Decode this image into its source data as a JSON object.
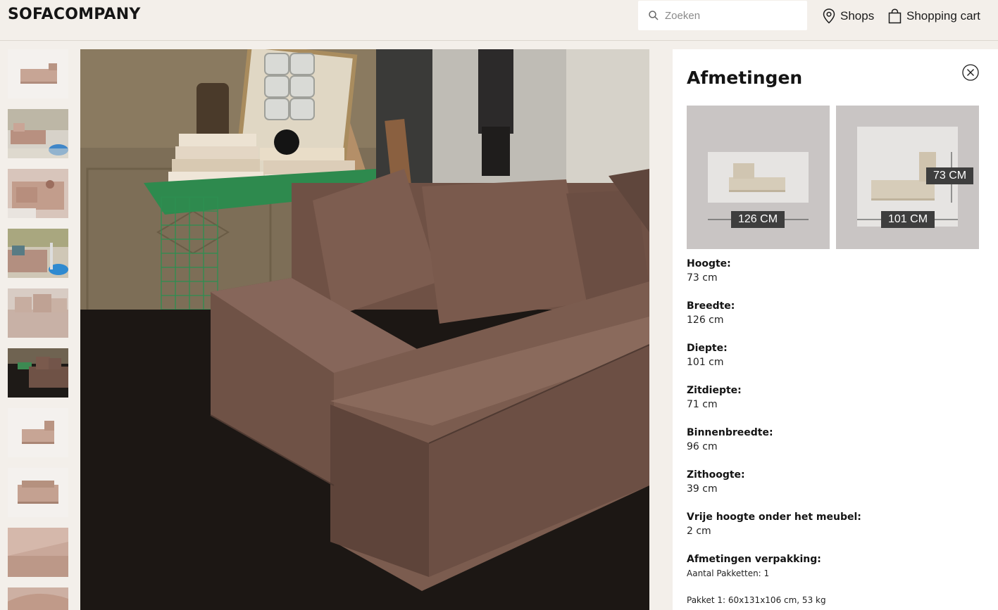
{
  "header": {
    "logo": "SOFACOMPANY",
    "search_placeholder": "Zoeken",
    "shops_label": "Shops",
    "cart_label": "Shopping cart"
  },
  "gallery": {
    "thumbnails": [
      "sofa-module-front",
      "living-room-blue-pouf",
      "sofa-top-view",
      "living-room-cushions",
      "sofa-cushions-closeup",
      "dark-room-sofa",
      "sofa-module-side",
      "sofa-module-back",
      "fabric-corner-closeup",
      "sofa-armrest-detail"
    ],
    "main_image": "brown-boucle-sofa-in-room"
  },
  "panel": {
    "title": "Afmetingen",
    "diagram_front_label": "126 CM",
    "diagram_side_width_label": "101 CM",
    "diagram_side_height_label": "73 CM",
    "specs": [
      {
        "label": "Hoogte:",
        "value": "73 cm"
      },
      {
        "label": "Breedte:",
        "value": "126 cm"
      },
      {
        "label": "Diepte:",
        "value": "101 cm"
      },
      {
        "label": "Zitdiepte:",
        "value": "71 cm"
      },
      {
        "label": "Binnenbreedte:",
        "value": "96 cm"
      },
      {
        "label": "Zithoogte:",
        "value": "39 cm"
      },
      {
        "label": "Vrije hoogte onder het meubel:",
        "value": "2 cm"
      }
    ],
    "packaging": {
      "label": "Afmetingen verpakking:",
      "packages_count": "Aantal Pakketten: 1",
      "package_1": "Pakket 1: 60x131x106 cm, 53 kg"
    }
  },
  "colors": {
    "background": "#f3efea",
    "sofa": "#7a5c4f",
    "diagram_bg": "#c9c5c4",
    "label_bg": "#3e3e3e"
  }
}
